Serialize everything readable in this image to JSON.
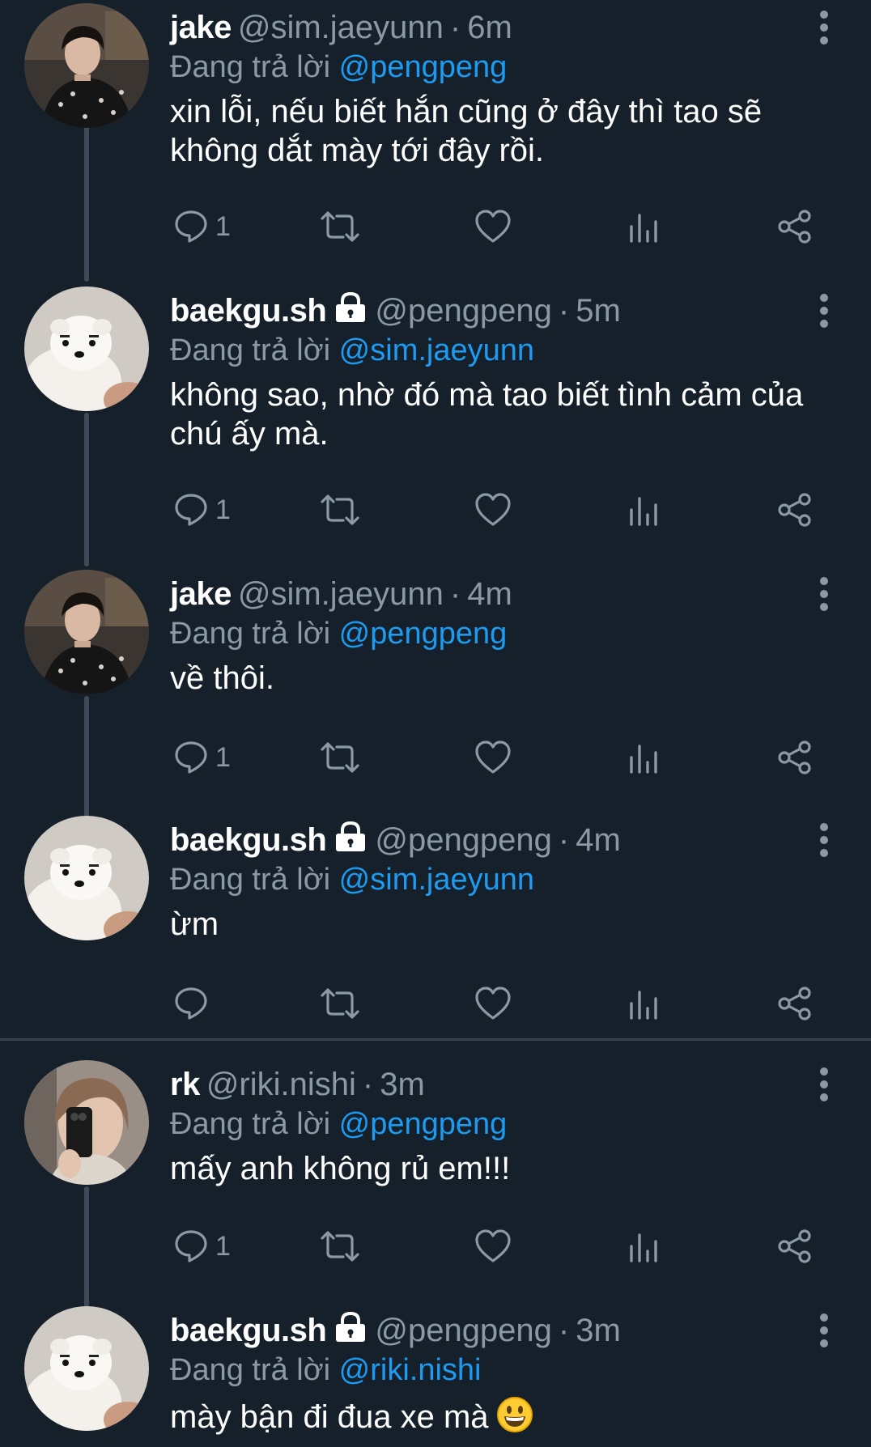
{
  "reply_prefix": "Đang trả lời",
  "tweets": [
    {
      "name": "jake",
      "handle": "@sim.jaeyunn",
      "time": "6m",
      "reply_to": "@pengpeng",
      "text": "xin lỗi, nếu biết hắn cũng ở đây thì tao sẽ không dắt mày tới đây rồi.",
      "reply_count": "1",
      "avatar": "man-portrait"
    },
    {
      "name": "baekgu.sh",
      "handle": "@pengpeng",
      "time": "5m",
      "reply_to": "@sim.jaeyunn",
      "text": "không sao, nhờ đó mà tao biết tình cảm của chú ấy mà.",
      "reply_count": "1",
      "avatar": "white-puppy"
    },
    {
      "name": "jake",
      "handle": "@sim.jaeyunn",
      "time": "4m",
      "reply_to": "@pengpeng",
      "text": "về thôi.",
      "reply_count": "1",
      "avatar": "man-portrait"
    },
    {
      "name": "baekgu.sh",
      "handle": "@pengpeng",
      "time": "4m",
      "reply_to": "@sim.jaeyunn",
      "text": "ừm",
      "reply_count": "",
      "avatar": "white-puppy"
    },
    {
      "name": "rk",
      "handle": "@riki.nishi",
      "time": "3m",
      "reply_to": "@pengpeng",
      "text": "mấy anh không rủ em!!!",
      "reply_count": "1",
      "avatar": "mirror-selfie"
    },
    {
      "name": "baekgu.sh",
      "handle": "@pengpeng",
      "time": "3m",
      "reply_to": "@riki.nishi",
      "text": "mày bận đi đua xe mà",
      "emoji": "grinning-face",
      "reply_count": "",
      "avatar": "white-puppy"
    }
  ],
  "colors": {
    "background": "#15202b",
    "text": "#ffffff",
    "secondary": "#8b98a5",
    "link": "#1d9bf0",
    "thread_line": "#3d4a57"
  }
}
